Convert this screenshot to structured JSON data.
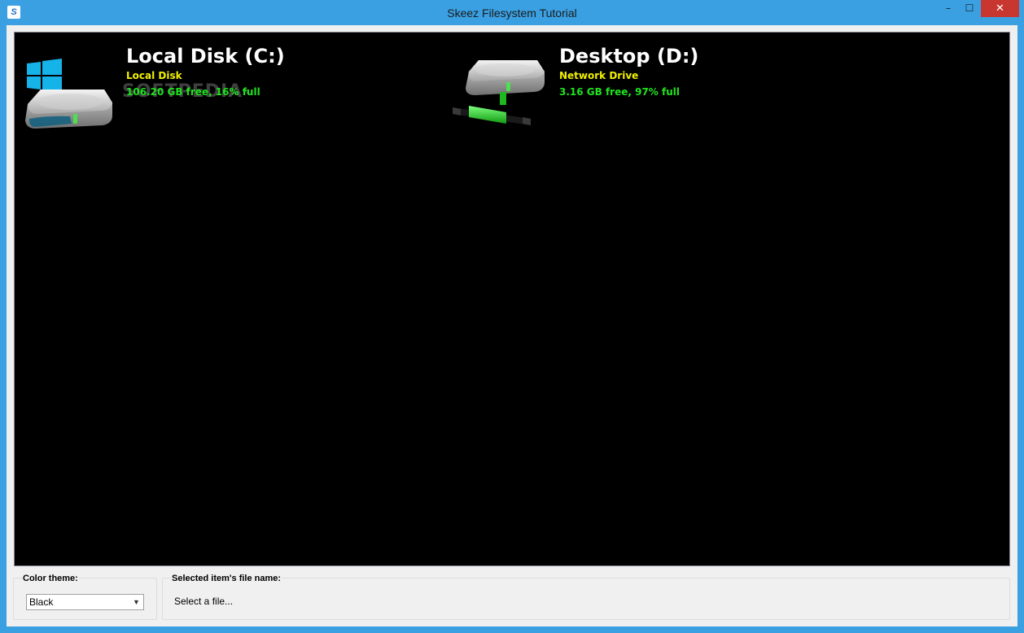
{
  "window": {
    "title": "Skeez Filesystem Tutorial",
    "app_icon_glyph": "S",
    "controls": {
      "minimize": "–",
      "maximize": "☐",
      "close": "✕"
    }
  },
  "drives": [
    {
      "name": "Local Disk (C:)",
      "type": "Local Disk",
      "free": "106.20 GB free, 16% full",
      "icon": "windows-hard-drive-icon"
    },
    {
      "name": "Desktop (D:)",
      "type": "Network Drive",
      "free": "3.16 GB free, 97% full",
      "icon": "network-drive-icon"
    }
  ],
  "watermark": {
    "text": "SOFTPEDIA",
    "mark": "®"
  },
  "color_theme": {
    "label": "Color theme:",
    "selected": "Black",
    "arrow": "▼"
  },
  "selected_file": {
    "label": "Selected item's file name:",
    "value": "Select a file..."
  },
  "colors": {
    "titlebar": "#3aa0e2",
    "viewer_bg": "#000000",
    "drive_name": "#ffffff",
    "drive_type": "#f0f000",
    "drive_free": "#1fe31f",
    "close_button": "#c7372f"
  }
}
